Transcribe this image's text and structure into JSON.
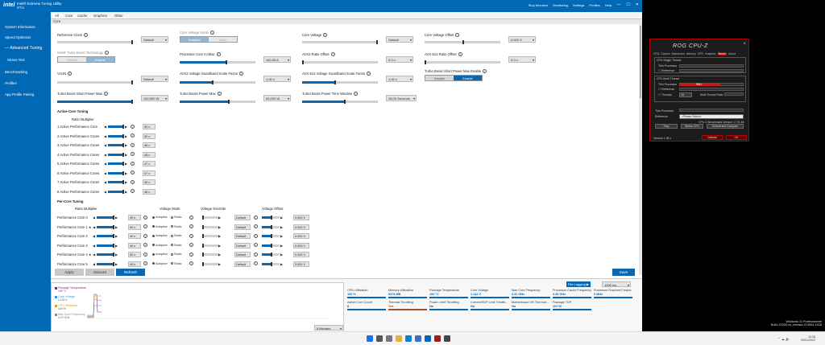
{
  "app": {
    "logo": "intel",
    "title_line1": "Intel® Extreme Tuning Utility",
    "title_line2": "XTU"
  },
  "top_actions": [
    "Stop Monitors",
    "Monitoring",
    "Settings",
    "Profiles",
    "Help"
  ],
  "sidebar": {
    "items": [
      {
        "label": "System Information"
      },
      {
        "label": "Speed Optimizer"
      },
      {
        "label": "— Advanced Tuning"
      },
      {
        "label": "Stress Test"
      },
      {
        "label": "Benchmarking"
      },
      {
        "label": "Profiles"
      },
      {
        "label": "App Profile Pairing"
      }
    ]
  },
  "tabs": [
    "All",
    "Core",
    "Cache",
    "Graphics",
    "Other"
  ],
  "section": "Core",
  "core": {
    "reference_clock": {
      "label": "Reference Clock",
      "value": "Default"
    },
    "turbo_boost_tech": {
      "label": "Intel® Turbo Boost Technology",
      "off": "Disable",
      "on": "Enable"
    },
    "vccin": {
      "label": "VccIN",
      "value": "Default"
    },
    "short_power_max": {
      "label": "Turbo Boost Short Power Max",
      "value": "100,000 W"
    },
    "core_voltage_mode": {
      "label": "Core Voltage Mode",
      "a": "Adaptive",
      "b": "Static"
    },
    "icc_max": {
      "label": "Processor Core IccMax",
      "value": "160.00 A"
    },
    "avx2_guardband": {
      "label": "AVX2 Voltage Guardband Scale Factor",
      "value": "1.00 x"
    },
    "power_max": {
      "label": "Turbo Boost Power Max",
      "value": "65,000 W"
    },
    "core_voltage": {
      "label": "Core Voltage",
      "value": "Default"
    },
    "avx2_ratio": {
      "label": "AVX2 Ratio Offset",
      "value": "0.0 x"
    },
    "avx512_guardband": {
      "label": "AVX-512 Voltage Guardband Scale Factor",
      "value": "1.00 x"
    },
    "time_window": {
      "label": "Turbo Boost Power Time Window",
      "value": "28.00 Seconds"
    },
    "core_voltage_offset": {
      "label": "Core Voltage Offset",
      "value": "0.000 V"
    },
    "avx512_ratio": {
      "label": "AVX-512 Ratio Offset",
      "value": "0.0 x"
    },
    "short_power_enable": {
      "label": "Turbo Boost Short Power Max Enable",
      "off": "Disable",
      "on": "Enable"
    }
  },
  "active_core": {
    "title": "Active-Core Tuning",
    "ratio_header": "Ratio Multiplier",
    "rows": [
      {
        "label": "1 Active Performance Core",
        "value": "50 x"
      },
      {
        "label": "2 Active Performance Cores",
        "value": "50 x"
      },
      {
        "label": "3 Active Performance Cores",
        "value": "48 x"
      },
      {
        "label": "4 Active Performance Cores",
        "value": "48 x"
      },
      {
        "label": "5 Active Performance Cores",
        "value": "47 x"
      },
      {
        "label": "6 Active Performance Cores",
        "value": "47 x"
      },
      {
        "label": "7 Active Performance Cores",
        "value": "46 x"
      },
      {
        "label": "8 Active Performance Cores",
        "value": "46 x"
      }
    ]
  },
  "per_core": {
    "title": "Per-Core Tuning",
    "headers": {
      "ratio": "Ratio Multiplier",
      "mode": "Voltage Mode",
      "override": "Voltage Override",
      "offset": "Voltage Offset"
    },
    "adaptive": "Adaptive",
    "static": "Static",
    "rows": [
      {
        "label": "Performance Core 0",
        "ratio": "49 x",
        "override": "Default",
        "offset": "0.000 V"
      },
      {
        "label": "Performance Core 1 ★",
        "ratio": "50 x",
        "override": "Default",
        "offset": "0.000 V"
      },
      {
        "label": "Performance Core 2",
        "ratio": "49 x",
        "override": "Default",
        "offset": "0.000 V"
      },
      {
        "label": "Performance Core 3",
        "ratio": "49 x",
        "override": "Default",
        "offset": "0.000 V"
      },
      {
        "label": "Performance Core 4 ★",
        "ratio": "50 x",
        "override": "Default",
        "offset": "0.000 V"
      },
      {
        "label": "Performance Core 5",
        "ratio": "49 x",
        "override": "Default",
        "offset": "0.000 V"
      }
    ]
  },
  "buttons": {
    "apply": "Apply",
    "discard": "Discard",
    "refresh": "Refresh",
    "save": "Save"
  },
  "monitor": {
    "legend": [
      {
        "name": "Package Temperature",
        "value": "100 °C",
        "color": "#8b1f8b"
      },
      {
        "name": "Core Voltage",
        "value": "1.142 V",
        "color": "#2aa0d8"
      },
      {
        "name": "CPU Utilization",
        "value": "100 %",
        "color": "#d9a000"
      },
      {
        "name": "Max Core Frequency",
        "value": "4.27 GHz",
        "color": "#8b8b8b"
      }
    ],
    "range": "5 Minutes",
    "logging": "File Logging ▶",
    "interval": "1000 ms",
    "metrics": [
      {
        "name": "CPU Utilization",
        "value": "100 %"
      },
      {
        "name": "Memory Utilization",
        "value": "5376 MB"
      },
      {
        "name": "Package Temperature",
        "value": "100 °C"
      },
      {
        "name": "Core Voltage",
        "value": "1.142 V"
      },
      {
        "name": "Max Core Frequency",
        "value": "4.31 GHz"
      },
      {
        "name": "Processor Cache Frequency",
        "value": "3.49 GHz"
      },
      {
        "name": "Processor Graphics Freque...",
        "value": "0 MHz"
      },
      {
        "name": "Active Core Count",
        "value": "8"
      },
      {
        "name": "Thermal Throttling",
        "value": "Yes"
      },
      {
        "name": "Power Limit Throttling",
        "value": "No"
      },
      {
        "name": "Current/EDP Limit Throttli...",
        "value": "No"
      },
      {
        "name": "Motherboard VR Thermal...",
        "value": "No"
      },
      {
        "name": "Package TDP",
        "value": "102 W"
      }
    ]
  },
  "cpuz": {
    "title": "ROG CPU-Z",
    "tabs": [
      "CPU",
      "Caches",
      "Mainboard",
      "Memory",
      "SPD",
      "Graphics",
      "Bench",
      "About"
    ],
    "single": "CPU Single Thread",
    "multi": "CPU Multi Thread",
    "this_processor": "This Processor",
    "reference": "Reference",
    "threads": "Threads",
    "threads_value": "16",
    "ratio": "Multi Thread Ratio",
    "bar_value": "9961",
    "reference_select": "<Please Select>",
    "version_info": "CPU-Z Benchmark Version 17.01.64",
    "btn_stop": "Stop",
    "btn_stress": "Stress CPU",
    "btn_submit": "Submit and Compare",
    "version": "Version 1.98.1",
    "validate": "Validate",
    "ok": "OK"
  },
  "taskbar": {
    "time": "10:36",
    "date": "09/01/2022",
    "os_line1": "Windows 11 Professionnel",
    "os_line2": "Build 22000.co_release.210604-1628"
  }
}
